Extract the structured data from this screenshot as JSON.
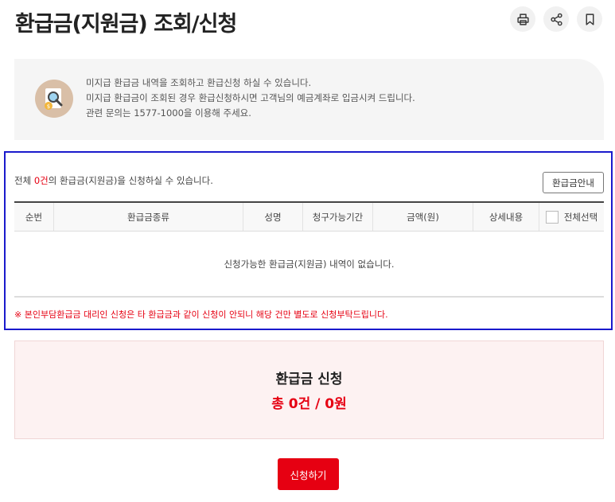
{
  "page": {
    "title": "환급금(지원금) 조회/신청"
  },
  "icons": {
    "print": "print-icon",
    "share": "share-icon",
    "bookmark": "bookmark-icon",
    "info": "magnifier-document-icon"
  },
  "info": {
    "lines": [
      "미지급 환급금 내역을 조회하고 환급신청 하실 수 있습니다.",
      "미지급 환급금이 조회된 경우 환급신청하시면 고객님의 예금계좌로 입금시켜 드립니다.",
      "관련 문의는 1577-1000을 이용해 주세요."
    ]
  },
  "summary": {
    "prefix": "전체 ",
    "count": "0건",
    "suffix": "의 환급금(지원금)을 신청하실 수 있습니다."
  },
  "guide_button": "환급금안내",
  "table": {
    "headers": [
      "순번",
      "환급금종류",
      "성명",
      "청구가능기간",
      "금액(원)",
      "상세내용",
      "전체선택"
    ],
    "empty_message": "신청가능한 환급금(지원금) 내역이 없습니다."
  },
  "notice": "※ 본인부담환급금 대리인 신청은 타 환급금과 같이 신청이 안되니 해당 건만 별도로 신청부탁드립니다.",
  "apply": {
    "title": "환급금 신청",
    "total": "총 0건 / 0원"
  },
  "submit_button": "신청하기",
  "colors": {
    "accent": "#e60012",
    "panel_border": "#1a1acc",
    "info_bg": "#f5f5f5",
    "apply_bg": "#fdf2f2"
  }
}
